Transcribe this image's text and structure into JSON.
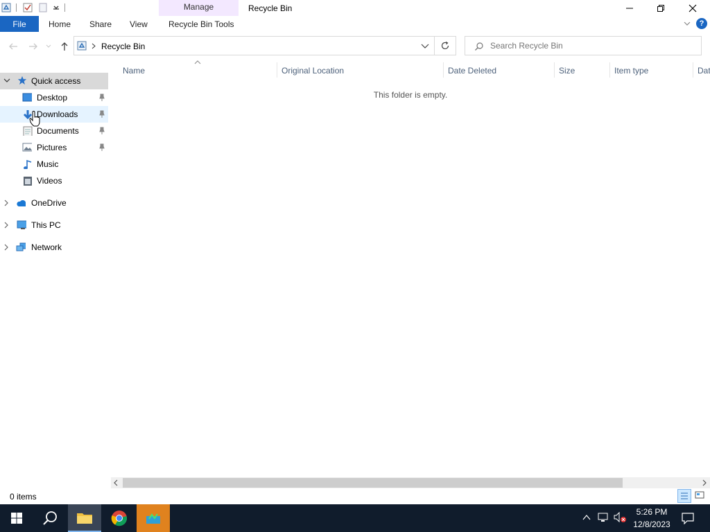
{
  "window": {
    "title": "Recycle Bin",
    "contextual_group": "Manage",
    "contextual_tab": "Recycle Bin Tools"
  },
  "ribbon": {
    "tabs": [
      "File",
      "Home",
      "Share",
      "View"
    ]
  },
  "address": {
    "path": "Recycle Bin",
    "search_placeholder": "Search Recycle Bin"
  },
  "nav": {
    "quick_access": "Quick access",
    "items": [
      {
        "label": "Desktop",
        "pinned": true
      },
      {
        "label": "Downloads",
        "pinned": true
      },
      {
        "label": "Documents",
        "pinned": true
      },
      {
        "label": "Pictures",
        "pinned": true
      },
      {
        "label": "Music",
        "pinned": false
      },
      {
        "label": "Videos",
        "pinned": false
      }
    ],
    "roots": [
      "OneDrive",
      "This PC",
      "Network"
    ]
  },
  "content": {
    "columns": [
      "Name",
      "Original Location",
      "Date Deleted",
      "Size",
      "Item type",
      "Dat"
    ],
    "empty_message": "This folder is empty."
  },
  "status": {
    "items_count": "0 items"
  },
  "taskbar": {
    "time": "5:26 PM",
    "date": "12/8/2023"
  },
  "colors": {
    "accent": "#1a66c2",
    "manage_bg": "#f3e8ff",
    "nav_selected": "#cce8ff",
    "quick_access_bg": "#d9d9d9",
    "taskbar": "#101c2c"
  }
}
